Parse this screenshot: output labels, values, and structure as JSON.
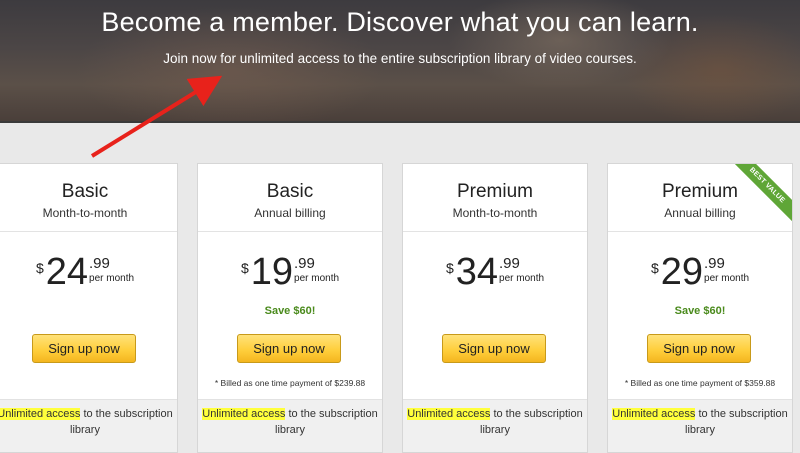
{
  "hero": {
    "title": "Become a member. Discover what you can learn.",
    "subtitle": "Join now for unlimited access to the entire subscription library of video courses."
  },
  "plans": [
    {
      "name": "Basic",
      "period": "Month-to-month",
      "currency": "$",
      "price_main": "24",
      "price_cents": ".99",
      "per": "per month",
      "save": "",
      "button": "Sign up now",
      "billed": "",
      "feature_highlight": "Unlimited access",
      "feature_text": " to the subscription library",
      "ribbon": ""
    },
    {
      "name": "Basic",
      "period": "Annual billing",
      "currency": "$",
      "price_main": "19",
      "price_cents": ".99",
      "per": "per month",
      "save": "Save $60!",
      "button": "Sign up now",
      "billed": "* Billed as one time payment of $239.88",
      "feature_highlight": "Unlimited access",
      "feature_text": " to the subscription library",
      "ribbon": ""
    },
    {
      "name": "Premium",
      "period": "Month-to-month",
      "currency": "$",
      "price_main": "34",
      "price_cents": ".99",
      "per": "per month",
      "save": "",
      "button": "Sign up now",
      "billed": "",
      "feature_highlight": "Unlimited access",
      "feature_text": " to the subscription library",
      "ribbon": ""
    },
    {
      "name": "Premium",
      "period": "Annual billing",
      "currency": "$",
      "price_main": "29",
      "price_cents": ".99",
      "per": "per month",
      "save": "Save $60!",
      "button": "Sign up now",
      "billed": "* Billed as one time payment of $359.88",
      "feature_highlight": "Unlimited access",
      "feature_text": " to the subscription library",
      "ribbon": "BEST VALUE"
    }
  ],
  "colors": {
    "button_gradient_top": "#ffe27a",
    "button_gradient_bottom": "#f4b61f",
    "save_text": "#4a8a1c",
    "highlight": "#ffff3c",
    "ribbon": "#5fa637",
    "annotation_arrow": "#e8221b"
  }
}
